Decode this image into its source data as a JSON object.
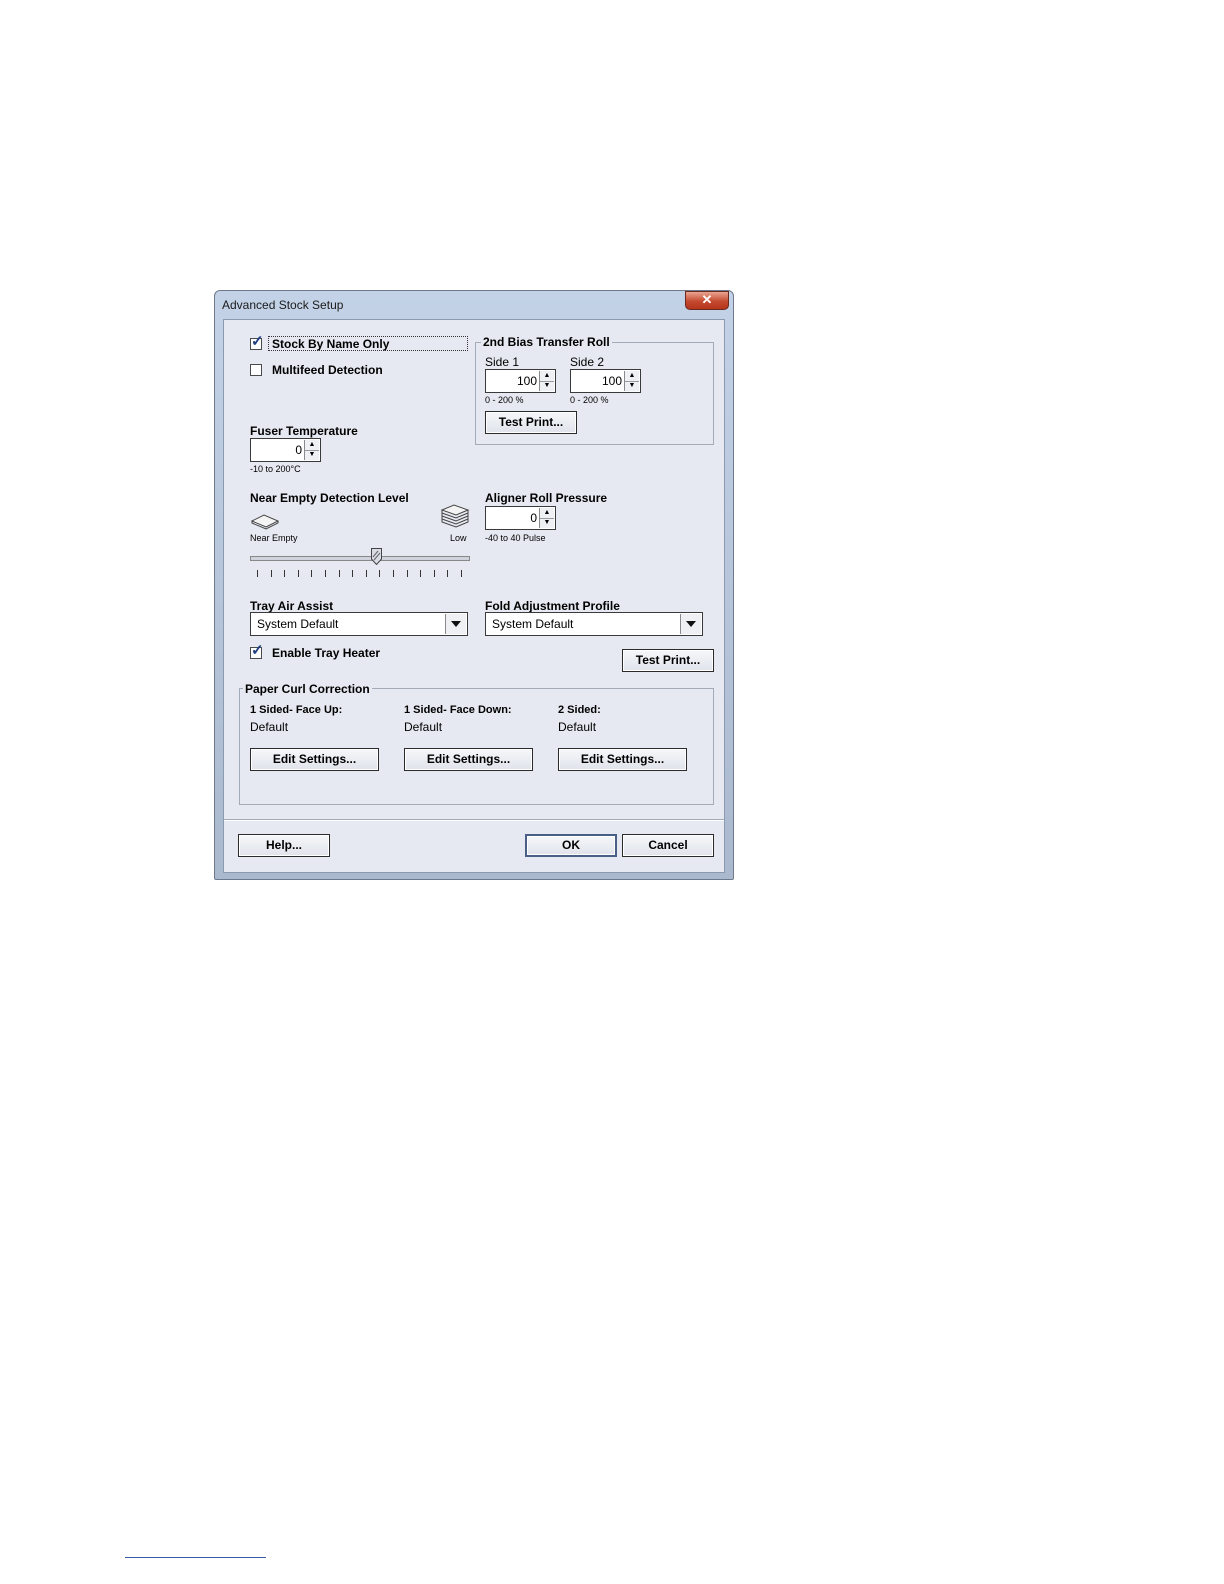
{
  "window": {
    "title": "Advanced Stock Setup",
    "close_symbol": "✕"
  },
  "options": {
    "stock_by_name_only": {
      "label": "Stock By Name Only",
      "checked": true
    },
    "multifeed_detection": {
      "label": "Multifeed Detection",
      "checked": false
    },
    "enable_tray_heater": {
      "label": "Enable Tray Heater",
      "checked": true
    },
    "check_mark": "✓"
  },
  "bias_transfer_roll": {
    "title": "2nd Bias Transfer Roll",
    "side1_label": "Side 1",
    "side1_value": "100",
    "side1_range": "0 - 200 %",
    "side2_label": "Side 2",
    "side2_value": "100",
    "side2_range": "0 - 200 %",
    "test_print_label": "Test Print..."
  },
  "fuser": {
    "label": "Fuser Temperature",
    "value": "0",
    "range": "-10 to 200°C"
  },
  "near_empty": {
    "label": "Near Empty Detection Level",
    "left_label": "Near Empty",
    "right_label": "Low",
    "slider_level": 0.58
  },
  "aligner": {
    "label": "Aligner Roll Pressure",
    "value": "0",
    "range": "-40 to 40 Pulse"
  },
  "tray_air_assist": {
    "label": "Tray Air Assist",
    "value": "System Default"
  },
  "fold_adjustment": {
    "label": "Fold Adjustment Profile",
    "value": "System Default",
    "test_print_label": "Test Print..."
  },
  "paper_curl": {
    "title": "Paper Curl Correction",
    "columns": [
      {
        "heading": "1 Sided- Face Up:",
        "value": "Default",
        "button": "Edit Settings..."
      },
      {
        "heading": "1 Sided- Face Down:",
        "value": "Default",
        "button": "Edit Settings..."
      },
      {
        "heading": "2 Sided:",
        "value": "Default",
        "button": "Edit Settings..."
      }
    ]
  },
  "footer": {
    "help_label": "Help...",
    "ok_label": "OK",
    "cancel_label": "Cancel"
  },
  "spin_arrows": {
    "up": "▲",
    "down": "▼"
  }
}
